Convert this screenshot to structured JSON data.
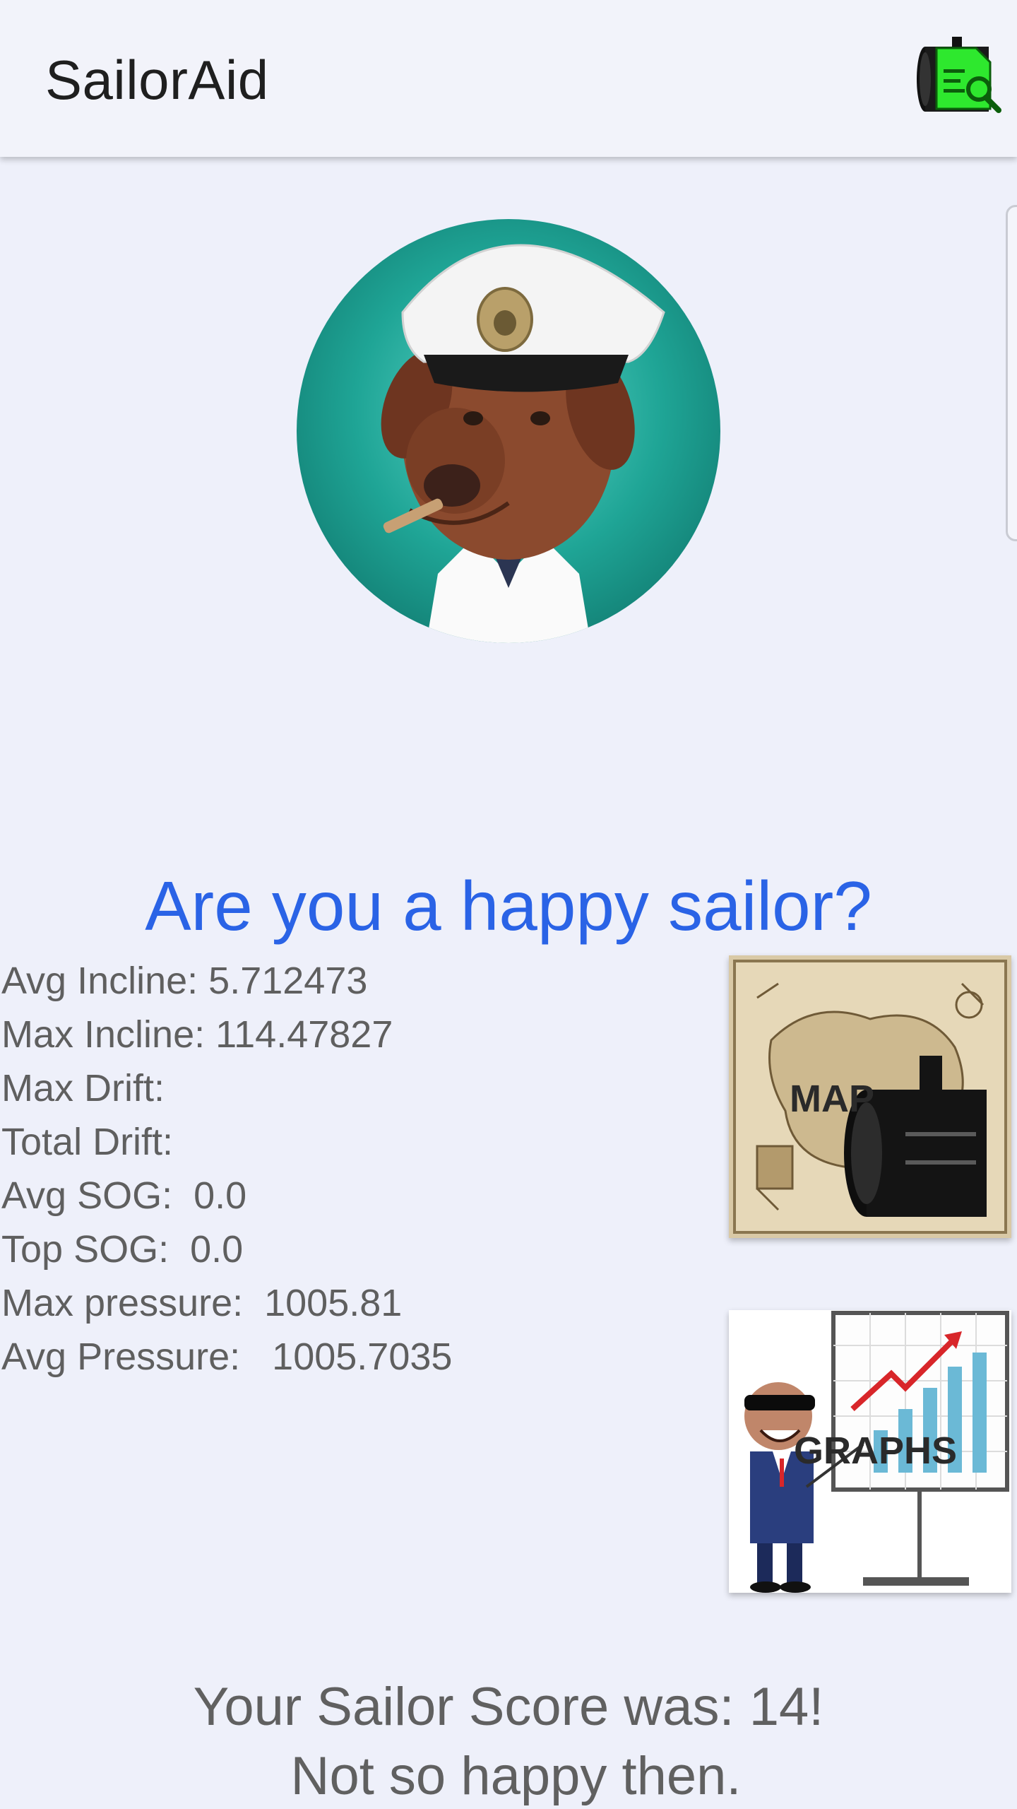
{
  "appbar": {
    "title": "SailorAid",
    "camera_icon": "camera-search-icon"
  },
  "main": {
    "avatar_icon": "sailor-dog-avatar",
    "headline": "Are you a happy sailor?",
    "stats": [
      "Avg Incline: 5.712473",
      "Max Incline: 114.47827",
      "Max Drift:",
      "Total Drift:",
      "Avg SOG:  0.0",
      "Top SOG:  0.0",
      "Max pressure:  1005.81",
      "Avg Pressure:   1005.7035"
    ],
    "map_tile": {
      "label": "MAP",
      "icon": "treasure-map-camera-icon"
    },
    "graphs_tile": {
      "label": "GRAPHS",
      "icon": "presenter-chart-icon"
    },
    "score_line1": "Your Sailor Score was: 14!",
    "score_line2": " Not so happy then."
  },
  "colors": {
    "background": "#eef0fa",
    "headline": "#2a63e6",
    "text": "#5f5f5f",
    "avatar_circle": "#1e9c8f",
    "camera_accent": "#2ee82e"
  }
}
